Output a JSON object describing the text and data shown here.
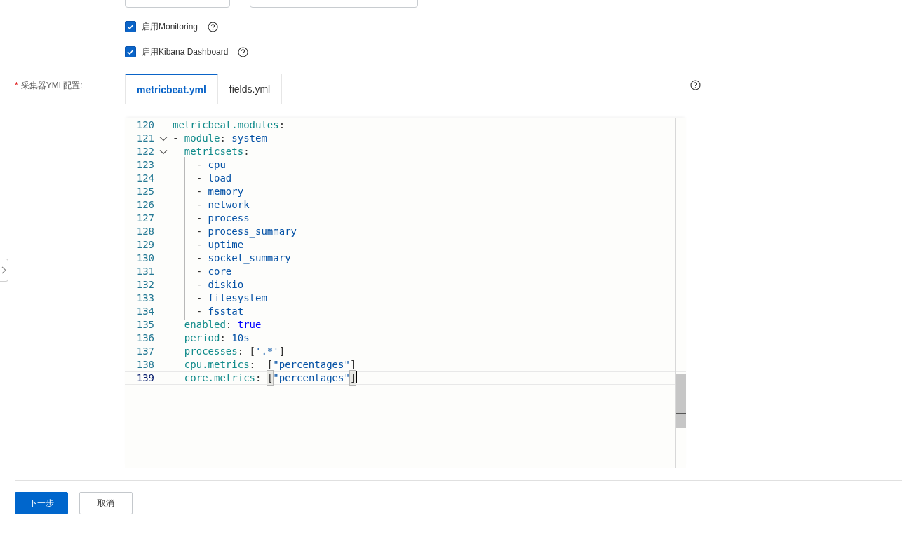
{
  "top_fields": [
    {
      "kind": "field"
    },
    {
      "kind": "field"
    }
  ],
  "options": [
    {
      "label": "启用Monitoring",
      "checked": true
    },
    {
      "label": "启用Kibana Dashboard",
      "checked": true
    }
  ],
  "config": {
    "label": "采集器YML配置:",
    "required_mark": "*",
    "tabs": [
      {
        "label": "metricbeat.yml",
        "selected": true
      },
      {
        "label": "fields.yml",
        "selected": false
      }
    ],
    "lines": [
      {
        "number": "120",
        "tokens": [
          {
            "kind": "key",
            "text": "metricbeat.modules"
          },
          {
            "kind": "punct",
            "text": ":"
          }
        ]
      },
      {
        "number": "121",
        "foldable": true,
        "tokens": [
          {
            "kind": "punct",
            "text": "- "
          },
          {
            "kind": "key",
            "text": "module"
          },
          {
            "kind": "punct",
            "text": ": "
          },
          {
            "kind": "value",
            "text": "system"
          }
        ]
      },
      {
        "number": "122",
        "foldable": true,
        "tokens": [
          {
            "kind": "key",
            "text": "  metricsets"
          },
          {
            "kind": "punct",
            "text": ":"
          }
        ]
      },
      {
        "number": "123",
        "tokens": [
          {
            "kind": "punct",
            "text": "    - "
          },
          {
            "kind": "value",
            "text": "cpu"
          }
        ]
      },
      {
        "number": "124",
        "tokens": [
          {
            "kind": "punct",
            "text": "    - "
          },
          {
            "kind": "value",
            "text": "load"
          }
        ]
      },
      {
        "number": "125",
        "tokens": [
          {
            "kind": "punct",
            "text": "    - "
          },
          {
            "kind": "value",
            "text": "memory"
          }
        ]
      },
      {
        "number": "126",
        "tokens": [
          {
            "kind": "punct",
            "text": "    - "
          },
          {
            "kind": "value",
            "text": "network"
          }
        ]
      },
      {
        "number": "127",
        "tokens": [
          {
            "kind": "punct",
            "text": "    - "
          },
          {
            "kind": "value",
            "text": "process"
          }
        ]
      },
      {
        "number": "128",
        "tokens": [
          {
            "kind": "punct",
            "text": "    - "
          },
          {
            "kind": "value",
            "text": "process_summary"
          }
        ]
      },
      {
        "number": "129",
        "tokens": [
          {
            "kind": "punct",
            "text": "    - "
          },
          {
            "kind": "value",
            "text": "uptime"
          }
        ]
      },
      {
        "number": "130",
        "tokens": [
          {
            "kind": "punct",
            "text": "    - "
          },
          {
            "kind": "value",
            "text": "socket_summary"
          }
        ]
      },
      {
        "number": "131",
        "tokens": [
          {
            "kind": "punct",
            "text": "    - "
          },
          {
            "kind": "value",
            "text": "core"
          }
        ]
      },
      {
        "number": "132",
        "tokens": [
          {
            "kind": "punct",
            "text": "    - "
          },
          {
            "kind": "value",
            "text": "diskio"
          }
        ]
      },
      {
        "number": "133",
        "tokens": [
          {
            "kind": "punct",
            "text": "    - "
          },
          {
            "kind": "value",
            "text": "filesystem"
          }
        ]
      },
      {
        "number": "134",
        "tokens": [
          {
            "kind": "punct",
            "text": "    - "
          },
          {
            "kind": "value",
            "text": "fsstat"
          }
        ]
      },
      {
        "number": "135",
        "tokens": [
          {
            "kind": "key",
            "text": "  enabled"
          },
          {
            "kind": "punct",
            "text": ": "
          },
          {
            "kind": "keyword",
            "text": "true"
          }
        ]
      },
      {
        "number": "136",
        "tokens": [
          {
            "kind": "key",
            "text": "  period"
          },
          {
            "kind": "punct",
            "text": ": "
          },
          {
            "kind": "value",
            "text": "10s"
          }
        ]
      },
      {
        "number": "137",
        "tokens": [
          {
            "kind": "key",
            "text": "  processes"
          },
          {
            "kind": "punct",
            "text": ": ["
          },
          {
            "kind": "string",
            "text": "'.*'"
          },
          {
            "kind": "punct",
            "text": "]"
          }
        ]
      },
      {
        "number": "138",
        "tokens": [
          {
            "kind": "key",
            "text": "  cpu.metrics"
          },
          {
            "kind": "punct",
            "text": ":  ["
          },
          {
            "kind": "string",
            "text": "\"percentages\""
          },
          {
            "kind": "punct",
            "text": "]"
          }
        ]
      },
      {
        "number": "139",
        "active": true,
        "tokens": [
          {
            "kind": "key",
            "text": "  core.metrics"
          },
          {
            "kind": "punct",
            "text": ": "
          },
          {
            "kind": "match",
            "text": "["
          },
          {
            "kind": "string",
            "text": "\"percentages\""
          },
          {
            "kind": "match",
            "text": "]"
          }
        ]
      }
    ]
  },
  "buttons": [
    {
      "label": "下一步",
      "kind": "primary"
    },
    {
      "label": "取消",
      "kind": "secondary"
    }
  ]
}
